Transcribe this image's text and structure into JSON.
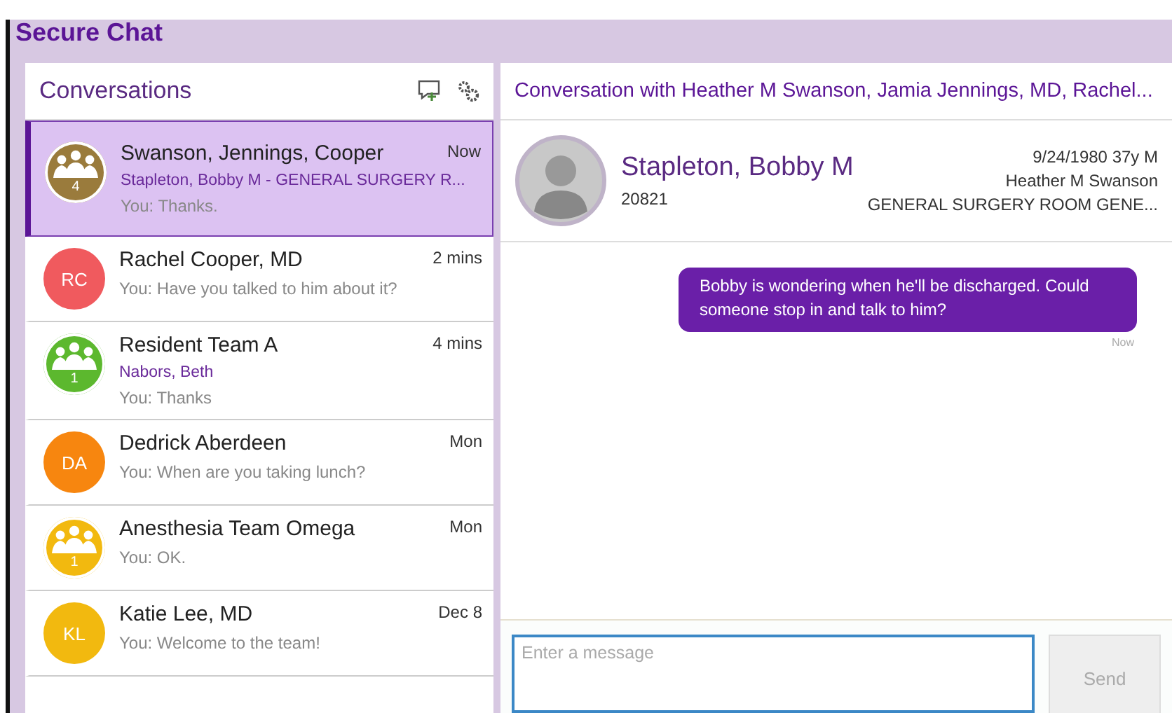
{
  "app_title": "Secure Chat",
  "conversations": {
    "title": "Conversations",
    "items": [
      {
        "name": "Swanson, Jennings, Cooper",
        "time": "Now",
        "patient": "Stapleton, Bobby M - GENERAL SURGERY R...",
        "preview": "You: Thanks.",
        "avatar": {
          "kind": "group",
          "count": "4",
          "color": "#9a7b3c"
        },
        "selected": true
      },
      {
        "name": "Rachel Cooper, MD",
        "time": "2 mins",
        "preview": "You: Have you talked to him about it?",
        "avatar": {
          "kind": "initials",
          "initials": "RC",
          "color": "#f05a5e"
        },
        "selected": false
      },
      {
        "name": "Resident Team A",
        "time": "4 mins",
        "patient": "Nabors, Beth",
        "preview": "You: Thanks",
        "avatar": {
          "kind": "group",
          "count": "1",
          "color": "#5cb82e"
        },
        "selected": false
      },
      {
        "name": "Dedrick Aberdeen",
        "time": "Mon",
        "preview": "You: When are you taking lunch?",
        "avatar": {
          "kind": "initials",
          "initials": "DA",
          "color": "#f7860f"
        },
        "selected": false
      },
      {
        "name": "Anesthesia Team Omega",
        "time": "Mon",
        "preview": "You: OK.",
        "avatar": {
          "kind": "group",
          "count": "1",
          "color": "#f2b90f"
        },
        "selected": false
      },
      {
        "name": "Katie Lee, MD",
        "time": "Dec 8",
        "preview": "You: Welcome to the team!",
        "avatar": {
          "kind": "initials",
          "initials": "KL",
          "color": "#f2b90f"
        },
        "selected": false
      }
    ]
  },
  "chat": {
    "title": "Conversation with Heather M Swanson, Jamia Jennings, MD, Rachel...",
    "patient": {
      "name": "Stapleton, Bobby M",
      "id": "20821",
      "dob": "9/24/1980 37y M",
      "provider": "Heather M Swanson",
      "location": "GENERAL SURGERY ROOM GENE..."
    },
    "messages": [
      {
        "text": "Bobby is wondering when he'll be discharged. Could someone stop in and talk to him?",
        "time": "Now"
      }
    ],
    "input": {
      "placeholder": "Enter a message"
    },
    "send": {
      "label": "Send",
      "disabled": true
    }
  }
}
